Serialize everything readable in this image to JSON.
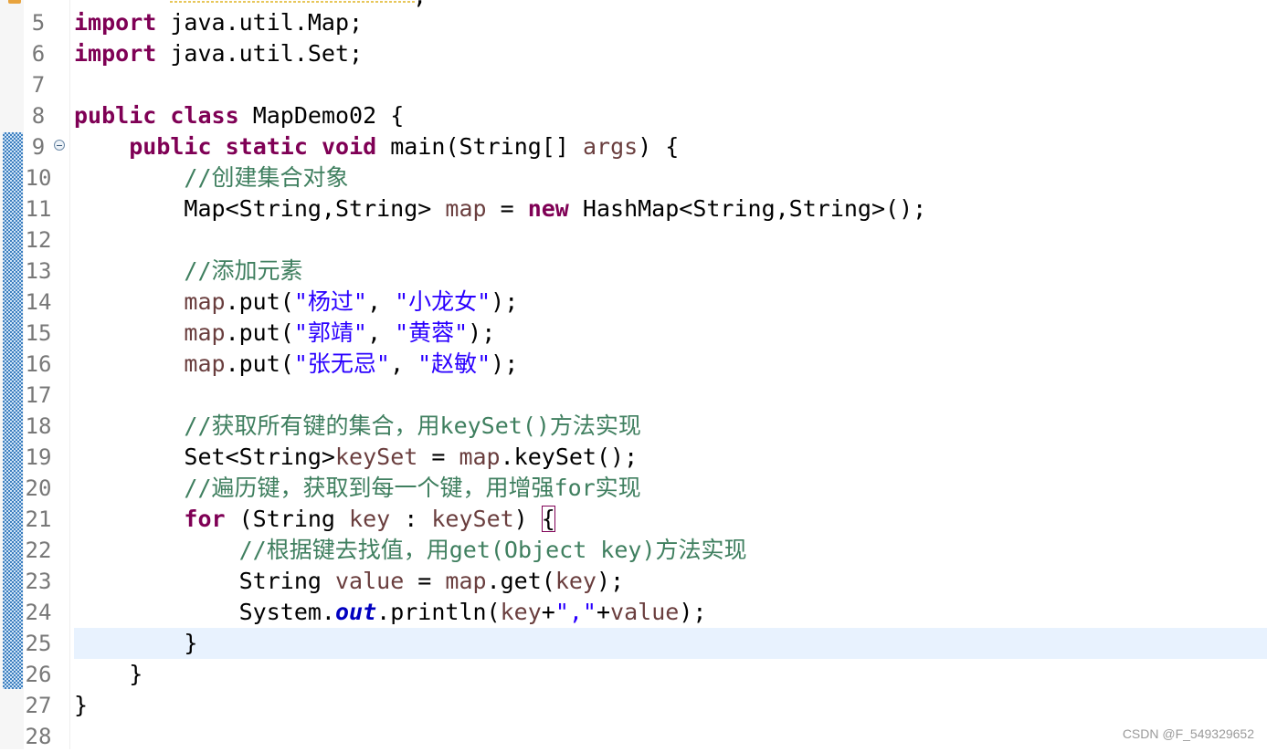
{
  "top_partial_text": ";",
  "code_lines": [
    {
      "num": "5",
      "segments": [
        {
          "t": "import",
          "c": "kw"
        },
        {
          "t": " java.util.Map;",
          "c": ""
        }
      ]
    },
    {
      "num": "6",
      "segments": [
        {
          "t": "import",
          "c": "kw"
        },
        {
          "t": " java.util.Set;",
          "c": ""
        }
      ]
    },
    {
      "num": "7",
      "segments": []
    },
    {
      "num": "8",
      "segments": [
        {
          "t": "public",
          "c": "kw"
        },
        {
          "t": " ",
          "c": ""
        },
        {
          "t": "class",
          "c": "kw"
        },
        {
          "t": " MapDemo02 {",
          "c": ""
        }
      ]
    },
    {
      "num": "9",
      "fold": true,
      "segments": [
        {
          "t": "    ",
          "c": ""
        },
        {
          "t": "public",
          "c": "kw"
        },
        {
          "t": " ",
          "c": ""
        },
        {
          "t": "static",
          "c": "kw"
        },
        {
          "t": " ",
          "c": ""
        },
        {
          "t": "void",
          "c": "kw"
        },
        {
          "t": " main(String[] ",
          "c": ""
        },
        {
          "t": "args",
          "c": "var"
        },
        {
          "t": ") {",
          "c": ""
        }
      ]
    },
    {
      "num": "10",
      "segments": [
        {
          "t": "        ",
          "c": ""
        },
        {
          "t": "//创建集合对象",
          "c": "cm"
        }
      ]
    },
    {
      "num": "11",
      "segments": [
        {
          "t": "        Map<String,String> ",
          "c": ""
        },
        {
          "t": "map",
          "c": "var"
        },
        {
          "t": " = ",
          "c": ""
        },
        {
          "t": "new",
          "c": "kw"
        },
        {
          "t": " HashMap<String,String>();",
          "c": ""
        }
      ]
    },
    {
      "num": "12",
      "segments": []
    },
    {
      "num": "13",
      "segments": [
        {
          "t": "        ",
          "c": ""
        },
        {
          "t": "//添加元素",
          "c": "cm"
        }
      ]
    },
    {
      "num": "14",
      "segments": [
        {
          "t": "        ",
          "c": ""
        },
        {
          "t": "map",
          "c": "var"
        },
        {
          "t": ".put(",
          "c": ""
        },
        {
          "t": "\"杨过\"",
          "c": "str"
        },
        {
          "t": ", ",
          "c": ""
        },
        {
          "t": "\"小龙女\"",
          "c": "str"
        },
        {
          "t": ");",
          "c": ""
        }
      ]
    },
    {
      "num": "15",
      "segments": [
        {
          "t": "        ",
          "c": ""
        },
        {
          "t": "map",
          "c": "var"
        },
        {
          "t": ".put(",
          "c": ""
        },
        {
          "t": "\"郭靖\"",
          "c": "str"
        },
        {
          "t": ", ",
          "c": ""
        },
        {
          "t": "\"黄蓉\"",
          "c": "str"
        },
        {
          "t": ");",
          "c": ""
        }
      ]
    },
    {
      "num": "16",
      "segments": [
        {
          "t": "        ",
          "c": ""
        },
        {
          "t": "map",
          "c": "var"
        },
        {
          "t": ".put(",
          "c": ""
        },
        {
          "t": "\"张无忌\"",
          "c": "str"
        },
        {
          "t": ", ",
          "c": ""
        },
        {
          "t": "\"赵敏\"",
          "c": "str"
        },
        {
          "t": ");",
          "c": ""
        }
      ]
    },
    {
      "num": "17",
      "segments": []
    },
    {
      "num": "18",
      "segments": [
        {
          "t": "        ",
          "c": ""
        },
        {
          "t": "//获取所有键的集合，用keySet()方法实现",
          "c": "cm"
        }
      ]
    },
    {
      "num": "19",
      "segments": [
        {
          "t": "        Set<String>",
          "c": ""
        },
        {
          "t": "keySet",
          "c": "var"
        },
        {
          "t": " = ",
          "c": ""
        },
        {
          "t": "map",
          "c": "var"
        },
        {
          "t": ".keySet();",
          "c": ""
        }
      ]
    },
    {
      "num": "20",
      "segments": [
        {
          "t": "        ",
          "c": ""
        },
        {
          "t": "//遍历键，获取到每一个键，用增强for实现",
          "c": "cm"
        }
      ]
    },
    {
      "num": "21",
      "segments": [
        {
          "t": "        ",
          "c": ""
        },
        {
          "t": "for",
          "c": "kw"
        },
        {
          "t": " (String ",
          "c": ""
        },
        {
          "t": "key",
          "c": "var"
        },
        {
          "t": " : ",
          "c": ""
        },
        {
          "t": "keySet",
          "c": "var"
        },
        {
          "t": ") ",
          "c": ""
        },
        {
          "t": "{",
          "c": "bracket-box"
        }
      ]
    },
    {
      "num": "22",
      "segments": [
        {
          "t": "            ",
          "c": ""
        },
        {
          "t": "//根据键去找值，用get(Object key)方法实现",
          "c": "cm"
        }
      ]
    },
    {
      "num": "23",
      "segments": [
        {
          "t": "            String ",
          "c": ""
        },
        {
          "t": "value",
          "c": "var"
        },
        {
          "t": " = ",
          "c": ""
        },
        {
          "t": "map",
          "c": "var"
        },
        {
          "t": ".get(",
          "c": ""
        },
        {
          "t": "key",
          "c": "var"
        },
        {
          "t": ");",
          "c": ""
        }
      ]
    },
    {
      "num": "24",
      "segments": [
        {
          "t": "            System.",
          "c": ""
        },
        {
          "t": "out",
          "c": "fld"
        },
        {
          "t": ".println(",
          "c": ""
        },
        {
          "t": "key",
          "c": "var"
        },
        {
          "t": "+",
          "c": ""
        },
        {
          "t": "\",\"",
          "c": "str"
        },
        {
          "t": "+",
          "c": ""
        },
        {
          "t": "value",
          "c": "var"
        },
        {
          "t": ");",
          "c": ""
        }
      ]
    },
    {
      "num": "25",
      "current": true,
      "segments": [
        {
          "t": "        }",
          "c": ""
        }
      ]
    },
    {
      "num": "26",
      "segments": [
        {
          "t": "    }",
          "c": ""
        }
      ]
    },
    {
      "num": "27",
      "segments": [
        {
          "t": "}",
          "c": ""
        }
      ]
    },
    {
      "num": "28",
      "segments": []
    }
  ],
  "watermark": "CSDN @F_549329652"
}
